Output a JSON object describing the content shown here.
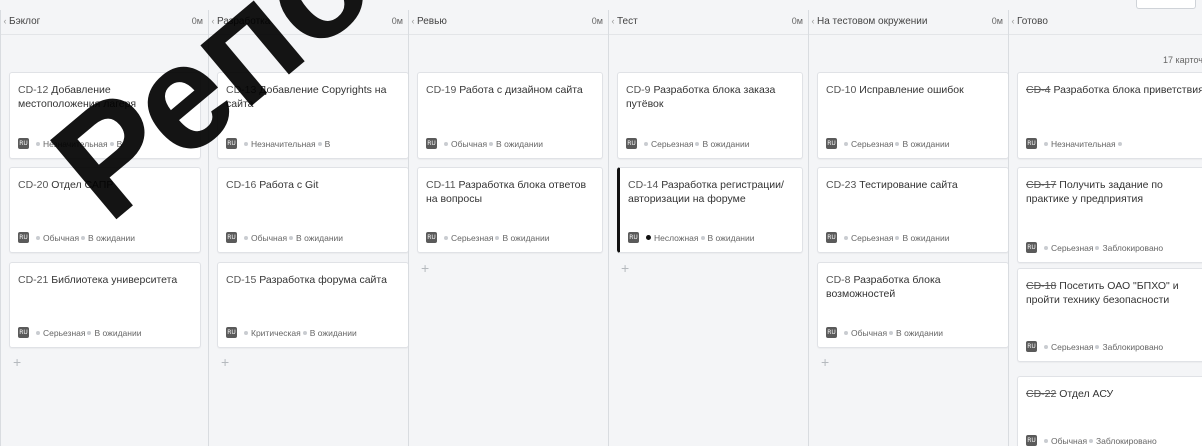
{
  "columns": [
    {
      "title": "Бэклог",
      "count": "0м",
      "cards": [
        {
          "key": "CD-12",
          "title": "Добавление местоположения лагеря",
          "priority": "Незначительная",
          "status": "В",
          "done": false,
          "flag": false
        },
        {
          "key": "CD-20",
          "title": "Отдел САПР",
          "priority": "Обычная",
          "status": "В ожидании",
          "done": false,
          "flag": false
        },
        {
          "key": "CD-21",
          "title": "Библиотека университета",
          "priority": "Серьезная",
          "status": "В ожидании",
          "done": false,
          "flag": false
        }
      ]
    },
    {
      "title": "Разработка",
      "count": "0м",
      "cards": [
        {
          "key": "CD-13",
          "title": "Добавление Copyrights на сайта",
          "priority": "Незначительная",
          "status": "В",
          "done": false,
          "flag": false
        },
        {
          "key": "CD-16",
          "title": "Работа с Git",
          "priority": "Обычная",
          "status": "В ожидании",
          "done": false,
          "flag": false
        },
        {
          "key": "CD-15",
          "title": "Разработка форума сайта",
          "priority": "Критическая",
          "status": "В ожидании",
          "done": false,
          "flag": false
        }
      ]
    },
    {
      "title": "Ревью",
      "count": "0м",
      "cards": [
        {
          "key": "CD-19",
          "title": "Работа с дизайном сайта",
          "priority": "Обычная",
          "status": "В ожидании",
          "done": false,
          "flag": false
        },
        {
          "key": "CD-11",
          "title": "Разработка блока ответов на вопросы",
          "priority": "Серьезная",
          "status": "В ожидании",
          "done": false,
          "flag": false
        }
      ]
    },
    {
      "title": "Тест",
      "count": "0м",
      "cards": [
        {
          "key": "CD-9",
          "title": "Разработка блока заказа путёвок",
          "priority": "Серьезная",
          "status": "В ожидании",
          "done": false,
          "flag": false
        },
        {
          "key": "CD-14",
          "title": "Разработка регистрации/ авторизации на форуме",
          "priority": "Несложная",
          "status": "В ожидании",
          "done": false,
          "flag": true
        }
      ]
    },
    {
      "title": "На тестовом окружении",
      "count": "0м",
      "cards": [
        {
          "key": "CD-10",
          "title": "Исправление ошибок",
          "priority": "Серьезная",
          "status": "В ожидании",
          "done": false,
          "flag": false
        },
        {
          "key": "CD-23",
          "title": "Тестирование сайта",
          "priority": "Серьезная",
          "status": "В ожидании",
          "done": false,
          "flag": false
        },
        {
          "key": "CD-8",
          "title": "Разработка блока возможностей",
          "priority": "Обычная",
          "status": "В ожидании",
          "done": false,
          "flag": false
        }
      ]
    },
    {
      "title": "Готово",
      "count": "",
      "cards_total": "17 карточ",
      "cards": [
        {
          "key": "CD-4",
          "title": "Разработка блока приветствия",
          "priority": "Незначительная",
          "status": "",
          "done": true,
          "flag": false
        },
        {
          "key": "CD-17",
          "title": "Получить задание по практике у предприятия",
          "priority": "Серьезная",
          "status": "Заблокировано",
          "done": true,
          "flag": false
        },
        {
          "key": "CD-18",
          "title": "Посетить ОАО \"БПХО\" и пройти технику безопасности",
          "priority": "Серьезная",
          "status": "Заблокировано",
          "done": true,
          "flag": false
        },
        {
          "key": "CD-22",
          "title": "Отдел АСУ",
          "priority": "Обычная",
          "status": "Заблокировано",
          "done": true,
          "flag": false
        }
      ]
    }
  ],
  "add_symbol": "+",
  "avatar_initials": "RU",
  "watermark": "Репозиторий"
}
